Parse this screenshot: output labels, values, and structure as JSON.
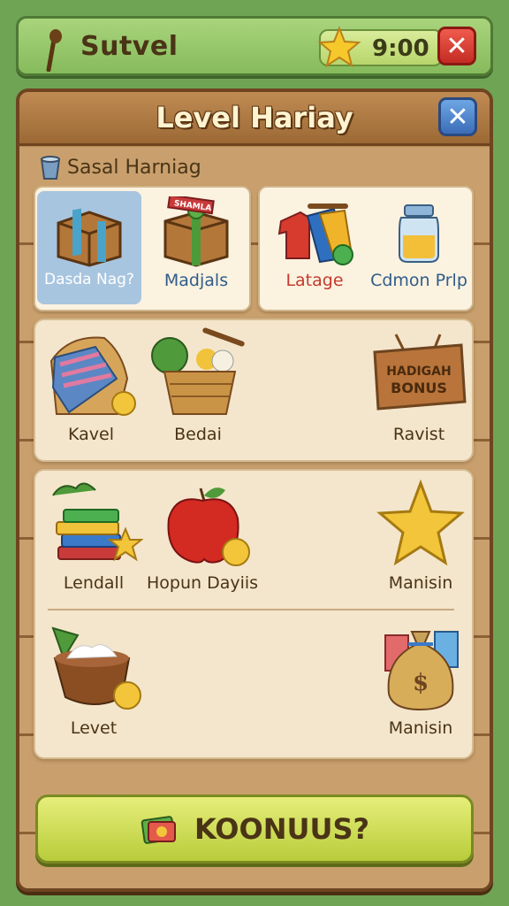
{
  "topbar": {
    "title": "Sutvel",
    "timer": "9:00"
  },
  "dialog": {
    "title": "Level Hariay"
  },
  "section": {
    "label": "Sasal Harniag"
  },
  "tabs": [
    {
      "label": "Dasda Nag?",
      "color": "#ffffff"
    },
    {
      "label": "Madjals",
      "color": "#2f5c8a"
    },
    {
      "label": "Latage",
      "color": "#c43a2e"
    },
    {
      "label": "Cdmon Prlp",
      "color": "#2f5c8a"
    }
  ],
  "tab_box_texts": {
    "gift_box": "SHAMLA"
  },
  "row1": [
    {
      "label": "Kavel"
    },
    {
      "label": "Bedai"
    },
    {
      "label": "Ravist",
      "sign": "HADIGAH BONUS"
    }
  ],
  "row2": [
    {
      "label": "Lendall"
    },
    {
      "label": "Hopun Dayiis"
    },
    {
      "label": "Manisin"
    }
  ],
  "row3": [
    {
      "label": "Levet"
    },
    {
      "label": "Manisin"
    }
  ],
  "action": {
    "label": "KOONUUS?"
  }
}
